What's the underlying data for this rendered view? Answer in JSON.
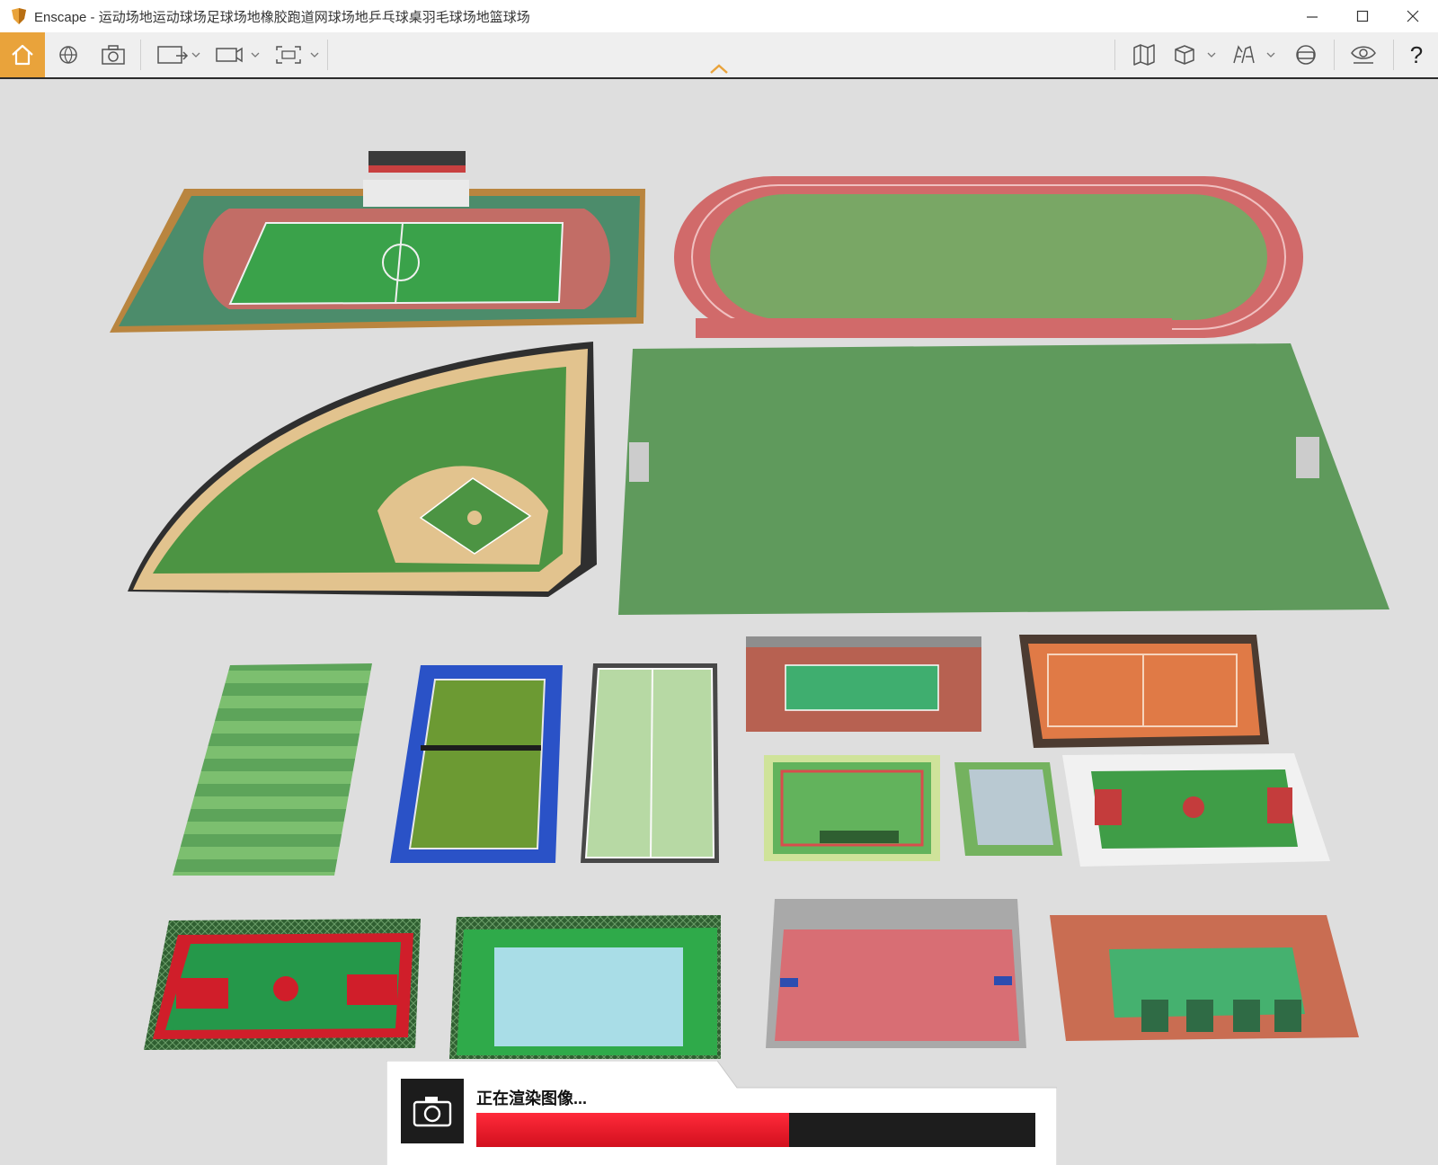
{
  "window": {
    "title": "Enscape - 运动场地运动球场足球场地橡胶跑道网球场地乒乓球桌羽毛球场地篮球场"
  },
  "toolbar": {
    "icons": [
      "home-icon",
      "globe-icon",
      "camera-icon",
      "view-export-icon",
      "video-export-icon",
      "batch-export-icon",
      "collapse-chevron-icon",
      "map-icon",
      "cube-icon",
      "assets-icon",
      "vr-headset-icon",
      "visibility-icon",
      "help-icon"
    ],
    "help_label": "?"
  },
  "render_status": {
    "message": "正在渲染图像...",
    "progress": 0.56
  },
  "colors": {
    "accent": "#e9a33b",
    "progress": "#e8182a"
  }
}
